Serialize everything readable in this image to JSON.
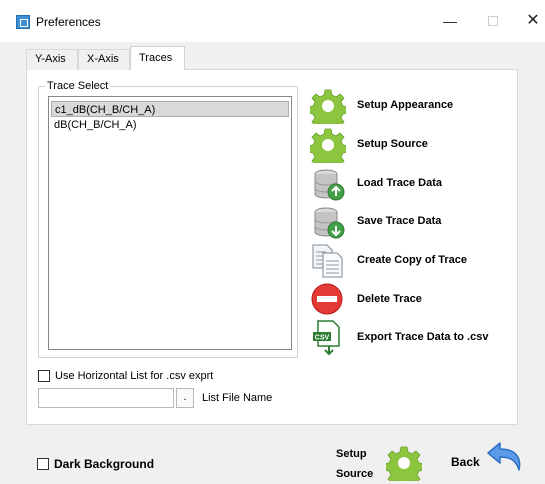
{
  "window": {
    "title": "Preferences",
    "min_glyph": "—",
    "close_glyph": "✕"
  },
  "tabs": [
    {
      "label": "Y-Axis",
      "active": false
    },
    {
      "label": "X-Axis",
      "active": false
    },
    {
      "label": "Traces",
      "active": true
    }
  ],
  "trace_select": {
    "title": "Trace Select",
    "items": [
      {
        "label": "c1_dB(CH_B/CH_A)",
        "selected": true
      },
      {
        "label": "dB(CH_B/CH_A)",
        "selected": false
      }
    ]
  },
  "actions": [
    {
      "label": "Setup Appearance",
      "icon": "gear-icon"
    },
    {
      "label": "Setup Source",
      "icon": "gear-icon"
    },
    {
      "label": "Load Trace Data",
      "icon": "database-load-icon"
    },
    {
      "label": "Save Trace Data",
      "icon": "database-save-icon"
    },
    {
      "label": "Create Copy of Trace",
      "icon": "copy-document-icon"
    },
    {
      "label": "Delete Trace",
      "icon": "delete-icon"
    },
    {
      "label": "Export Trace Data to .csv",
      "icon": "csv-export-icon"
    }
  ],
  "csv_options": {
    "horizontal_list_label": "Use Horizontal List for .csv exprt",
    "horizontal_list_checked": false,
    "file_name_value": "",
    "browse_label": ".",
    "file_name_label": "List File Name"
  },
  "bottom": {
    "dark_background_label": "Dark Background",
    "dark_background_checked": false,
    "setup_source_line1": "Setup",
    "setup_source_line2": "Source",
    "back_label": "Back"
  },
  "colors": {
    "gear_green": "#8cc63f",
    "delete_red": "#e53935",
    "back_blue": "#3a7fd5",
    "database_green": "#43a047"
  }
}
